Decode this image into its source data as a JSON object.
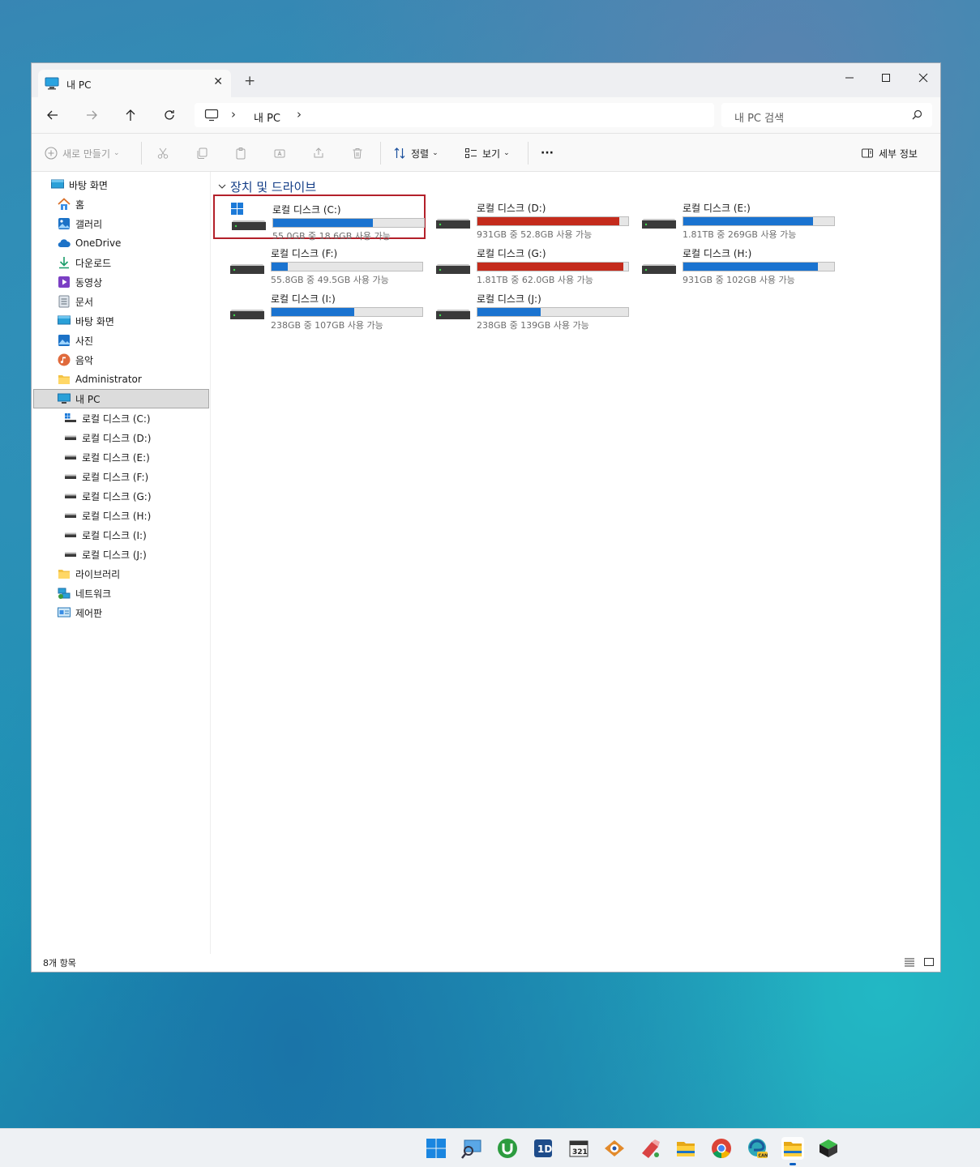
{
  "window": {
    "tab_title": "내 PC",
    "new_tab": "+",
    "close_tab": "✕",
    "minimize": "—",
    "maximize": "☐",
    "close": "✕"
  },
  "address": {
    "breadcrumb": "내 PC",
    "separator": "›",
    "search_placeholder": "내 PC 검색"
  },
  "toolbar": {
    "new_label": "새로 만들기",
    "sort_label": "정렬",
    "view_label": "보기",
    "more_label": "···",
    "details_label": "세부 정보"
  },
  "sidebar": {
    "items": [
      {
        "label": "바탕 화면",
        "icon": "desktop-icon"
      },
      {
        "label": "홈",
        "icon": "home-icon"
      },
      {
        "label": "갤러리",
        "icon": "gallery-icon"
      },
      {
        "label": "OneDrive",
        "icon": "onedrive-icon"
      },
      {
        "label": "다운로드",
        "icon": "download-icon"
      },
      {
        "label": "동영상",
        "icon": "video-icon"
      },
      {
        "label": "문서",
        "icon": "document-icon"
      },
      {
        "label": "바탕 화면",
        "icon": "desktop-icon"
      },
      {
        "label": "사진",
        "icon": "pictures-icon"
      },
      {
        "label": "음악",
        "icon": "music-icon"
      },
      {
        "label": "Administrator",
        "icon": "folder-icon"
      },
      {
        "label": "내 PC",
        "icon": "pc-icon"
      },
      {
        "label": "로컬 디스크 (C:)",
        "icon": "windows-drive-icon"
      },
      {
        "label": "로컬 디스크 (D:)",
        "icon": "drive-icon"
      },
      {
        "label": "로컬 디스크 (E:)",
        "icon": "drive-icon"
      },
      {
        "label": "로컬 디스크 (F:)",
        "icon": "drive-icon"
      },
      {
        "label": "로컬 디스크 (G:)",
        "icon": "drive-icon"
      },
      {
        "label": "로컬 디스크 (H:)",
        "icon": "drive-icon"
      },
      {
        "label": "로컬 디스크 (I:)",
        "icon": "drive-icon"
      },
      {
        "label": "로컬 디스크 (J:)",
        "icon": "drive-icon"
      },
      {
        "label": "라이브러리",
        "icon": "library-icon"
      },
      {
        "label": "네트워크",
        "icon": "network-icon"
      },
      {
        "label": "제어판",
        "icon": "control-panel-icon"
      }
    ]
  },
  "main": {
    "section_title": "장치 및 드라이브",
    "drives": [
      {
        "name": "로컬 디스크 (C:)",
        "free": "55.0GB 중 18.6GB 사용 가능",
        "used_fraction": 0.66,
        "color": "#1a73d0"
      },
      {
        "name": "로컬 디스크 (D:)",
        "free": "931GB 중 52.8GB 사용 가능",
        "used_fraction": 0.94,
        "color": "#c42b1c"
      },
      {
        "name": "로컬 디스크 (E:)",
        "free": "1.81TB 중 269GB 사용 가능",
        "used_fraction": 0.86,
        "color": "#1a73d0"
      },
      {
        "name": "로컬 디스크 (F:)",
        "free": "55.8GB 중 49.5GB 사용 가능",
        "used_fraction": 0.11,
        "color": "#1a73d0"
      },
      {
        "name": "로컬 디스크 (G:)",
        "free": "1.81TB 중 62.0GB 사용 가능",
        "used_fraction": 0.97,
        "color": "#c42b1c"
      },
      {
        "name": "로컬 디스크 (H:)",
        "free": "931GB 중 102GB 사용 가능",
        "used_fraction": 0.89,
        "color": "#1a73d0"
      },
      {
        "name": "로컬 디스크 (I:)",
        "free": "238GB 중 107GB 사용 가능",
        "used_fraction": 0.55,
        "color": "#1a73d0"
      },
      {
        "name": "로컬 디스크 (J:)",
        "free": "238GB 중 139GB 사용 가능",
        "used_fraction": 0.42,
        "color": "#1a73d0"
      }
    ]
  },
  "status": {
    "item_count": "8개 항목"
  },
  "taskbar": {
    "apps": [
      "start-icon",
      "remote-desktop-icon",
      "utorrent-icon",
      "app-1d-icon",
      "media-player-classic-icon",
      "eye-app-icon",
      "flag-app-icon",
      "file-explorer-icon",
      "chrome-icon",
      "edge-canary-icon",
      "file-explorer-active-icon",
      "box-app-icon"
    ]
  }
}
